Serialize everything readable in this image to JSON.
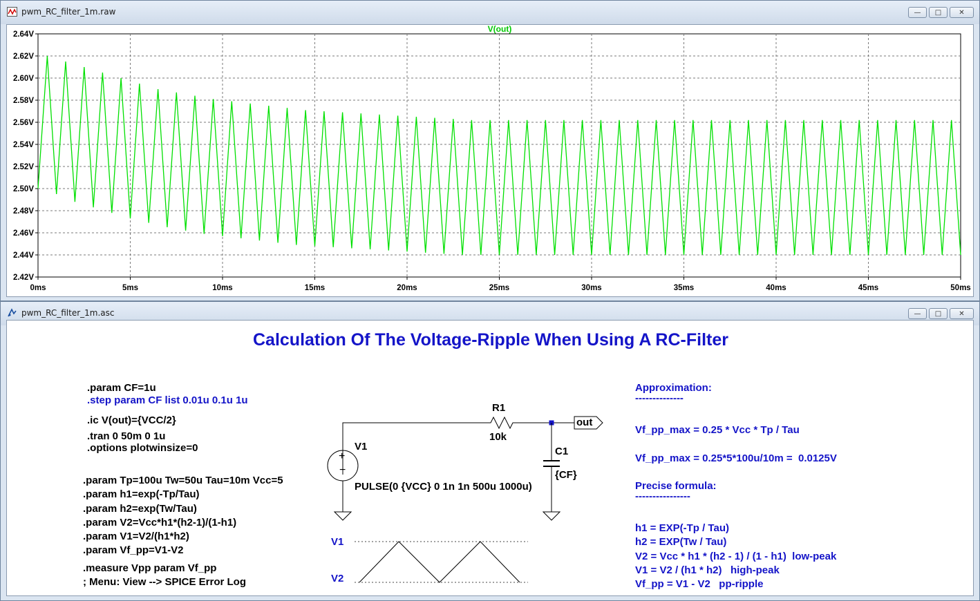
{
  "plot_window": {
    "title": "pwm_RC_filter_1m.raw",
    "trace_name": "V(out)",
    "trace_color": "#00e000",
    "y_ticks": [
      "2.64V",
      "2.62V",
      "2.60V",
      "2.58V",
      "2.56V",
      "2.54V",
      "2.52V",
      "2.50V",
      "2.48V",
      "2.46V",
      "2.44V",
      "2.42V"
    ],
    "x_ticks": [
      "0ms",
      "5ms",
      "10ms",
      "15ms",
      "20ms",
      "25ms",
      "30ms",
      "35ms",
      "40ms",
      "45ms",
      "50ms"
    ],
    "buttons": {
      "minimize": "—",
      "maximize": "□",
      "close": "✕"
    }
  },
  "chart_data": {
    "type": "line",
    "title": "",
    "xlabel": "",
    "ylabel": "",
    "xlim": [
      0,
      50
    ],
    "ylim": [
      2.42,
      2.64
    ],
    "grid": true,
    "series": [
      {
        "name": "V(out)",
        "x_unit": "ms",
        "y_unit": "V",
        "points": [
          [
            0,
            2.5
          ],
          [
            0.5,
            2.62
          ],
          [
            1.0,
            2.495
          ],
          [
            1.5,
            2.615
          ],
          [
            2.0,
            2.488
          ],
          [
            2.5,
            2.61
          ],
          [
            3.0,
            2.483
          ],
          [
            3.5,
            2.605
          ],
          [
            4.0,
            2.478
          ],
          [
            4.5,
            2.6
          ],
          [
            5.0,
            2.473
          ],
          [
            5.5,
            2.595
          ],
          [
            6.0,
            2.469
          ],
          [
            6.5,
            2.59
          ],
          [
            7.0,
            2.465
          ],
          [
            7.5,
            2.587
          ],
          [
            8.0,
            2.462
          ],
          [
            8.5,
            2.584
          ],
          [
            9.0,
            2.459
          ],
          [
            9.5,
            2.581
          ],
          [
            10.0,
            2.457
          ],
          [
            10.5,
            2.579
          ],
          [
            11.0,
            2.455
          ],
          [
            11.5,
            2.577
          ],
          [
            12.0,
            2.453
          ],
          [
            12.5,
            2.575
          ],
          [
            13.0,
            2.451
          ],
          [
            13.5,
            2.573
          ],
          [
            14.0,
            2.449
          ],
          [
            14.5,
            2.571
          ],
          [
            15.0,
            2.448
          ],
          [
            15.5,
            2.57
          ],
          [
            16.0,
            2.447
          ],
          [
            16.5,
            2.569
          ],
          [
            17.0,
            2.446
          ],
          [
            17.5,
            2.568
          ],
          [
            18.0,
            2.445
          ],
          [
            18.5,
            2.567
          ],
          [
            19.0,
            2.444
          ],
          [
            19.5,
            2.566
          ],
          [
            20.0,
            2.443
          ],
          [
            20.5,
            2.565
          ],
          [
            21.0,
            2.442
          ],
          [
            21.5,
            2.564
          ],
          [
            22.0,
            2.441
          ],
          [
            22.5,
            2.563
          ],
          [
            23.0,
            2.44
          ],
          [
            23.5,
            2.562
          ],
          [
            24.0,
            2.44
          ],
          [
            24.5,
            2.562
          ],
          [
            25.0,
            2.44
          ],
          [
            25.5,
            2.562
          ],
          [
            26.0,
            2.44
          ],
          [
            26.5,
            2.562
          ],
          [
            27.0,
            2.44
          ],
          [
            27.5,
            2.562
          ],
          [
            28.0,
            2.44
          ],
          [
            28.5,
            2.562
          ],
          [
            29.0,
            2.44
          ],
          [
            29.5,
            2.562
          ],
          [
            30.0,
            2.44
          ],
          [
            30.5,
            2.562
          ],
          [
            31.0,
            2.44
          ],
          [
            31.5,
            2.562
          ],
          [
            32.0,
            2.44
          ],
          [
            32.5,
            2.562
          ],
          [
            33.0,
            2.44
          ],
          [
            33.5,
            2.562
          ],
          [
            34.0,
            2.44
          ],
          [
            34.5,
            2.562
          ],
          [
            35.0,
            2.44
          ],
          [
            35.5,
            2.562
          ],
          [
            36.0,
            2.44
          ],
          [
            36.5,
            2.562
          ],
          [
            37.0,
            2.44
          ],
          [
            37.5,
            2.562
          ],
          [
            38.0,
            2.44
          ],
          [
            38.5,
            2.562
          ],
          [
            39.0,
            2.44
          ],
          [
            39.5,
            2.562
          ],
          [
            40.0,
            2.44
          ],
          [
            40.5,
            2.562
          ],
          [
            41.0,
            2.44
          ],
          [
            41.5,
            2.562
          ],
          [
            42.0,
            2.44
          ],
          [
            42.5,
            2.562
          ],
          [
            43.0,
            2.44
          ],
          [
            43.5,
            2.562
          ],
          [
            44.0,
            2.44
          ],
          [
            44.5,
            2.562
          ],
          [
            45.0,
            2.44
          ],
          [
            45.5,
            2.562
          ],
          [
            46.0,
            2.44
          ],
          [
            46.5,
            2.562
          ],
          [
            47.0,
            2.44
          ],
          [
            47.5,
            2.562
          ],
          [
            48.0,
            2.44
          ],
          [
            48.5,
            2.562
          ],
          [
            49.0,
            2.44
          ],
          [
            49.5,
            2.562
          ],
          [
            50.0,
            2.44
          ]
        ]
      }
    ]
  },
  "schematic_window": {
    "title": "pwm_RC_filter_1m.asc",
    "buttons": {
      "minimize": "—",
      "maximize": "□",
      "close": "✕"
    },
    "heading": "Calculation Of The Voltage-Ripple When Using A RC-Filter",
    "heading_color": "#1414c8",
    "directives_a": {
      "param_cf": ".param CF=1u",
      "step": ".step param CF list 0.01u 0.1u 1u",
      "ic": ".ic V(out)={VCC/2}",
      "tran": ".tran 0 50m 0 1u",
      "options": ".options plotwinsize=0"
    },
    "directives_b": [
      ".param Tp=100u Tw=50u Tau=10m Vcc=5",
      ".param h1=exp(-Tp/Tau)",
      ".param h2=exp(Tw/Tau)",
      ".param V2=Vcc*h1*(h2-1)/(1-h1)",
      ".param V1=V2/(h1*h2)",
      ".param Vf_pp=V1-V2"
    ],
    "measure": ".measure Vpp param Vf_pp",
    "menu_hint": "; Menu: View --> SPICE Error Log",
    "circuit": {
      "r1_name": "R1",
      "r1_value": "10k",
      "c1_name": "C1",
      "c1_value": "{CF}",
      "v1_name": "V1",
      "v1_value": "PULSE(0 {VCC} 0 1n 1n 500u 1000u)",
      "net_label": "out",
      "plus": "+",
      "minus": "−"
    },
    "ripple_sketch": {
      "top_label": "V1",
      "bottom_label": "V2"
    },
    "approximation": {
      "title": "Approximation:",
      "underline": "--------------",
      "formula": "Vf_pp_max = 0.25 * Vcc * Tp / Tau",
      "example": "Vf_pp_max = 0.25*5*100u/10m =  0.0125V"
    },
    "precise": {
      "title": "Precise formula:",
      "underline": "----------------",
      "lines": [
        "h1 = EXP(-Tp / Tau)",
        "h2 = EXP(Tw / Tau)",
        "V2 = Vcc * h1 * (h2 - 1) / (1 - h1)  low-peak",
        "V1 = V2 / (h1 * h2)   high-peak",
        "Vf_pp = V1 - V2   pp-ripple"
      ]
    }
  }
}
